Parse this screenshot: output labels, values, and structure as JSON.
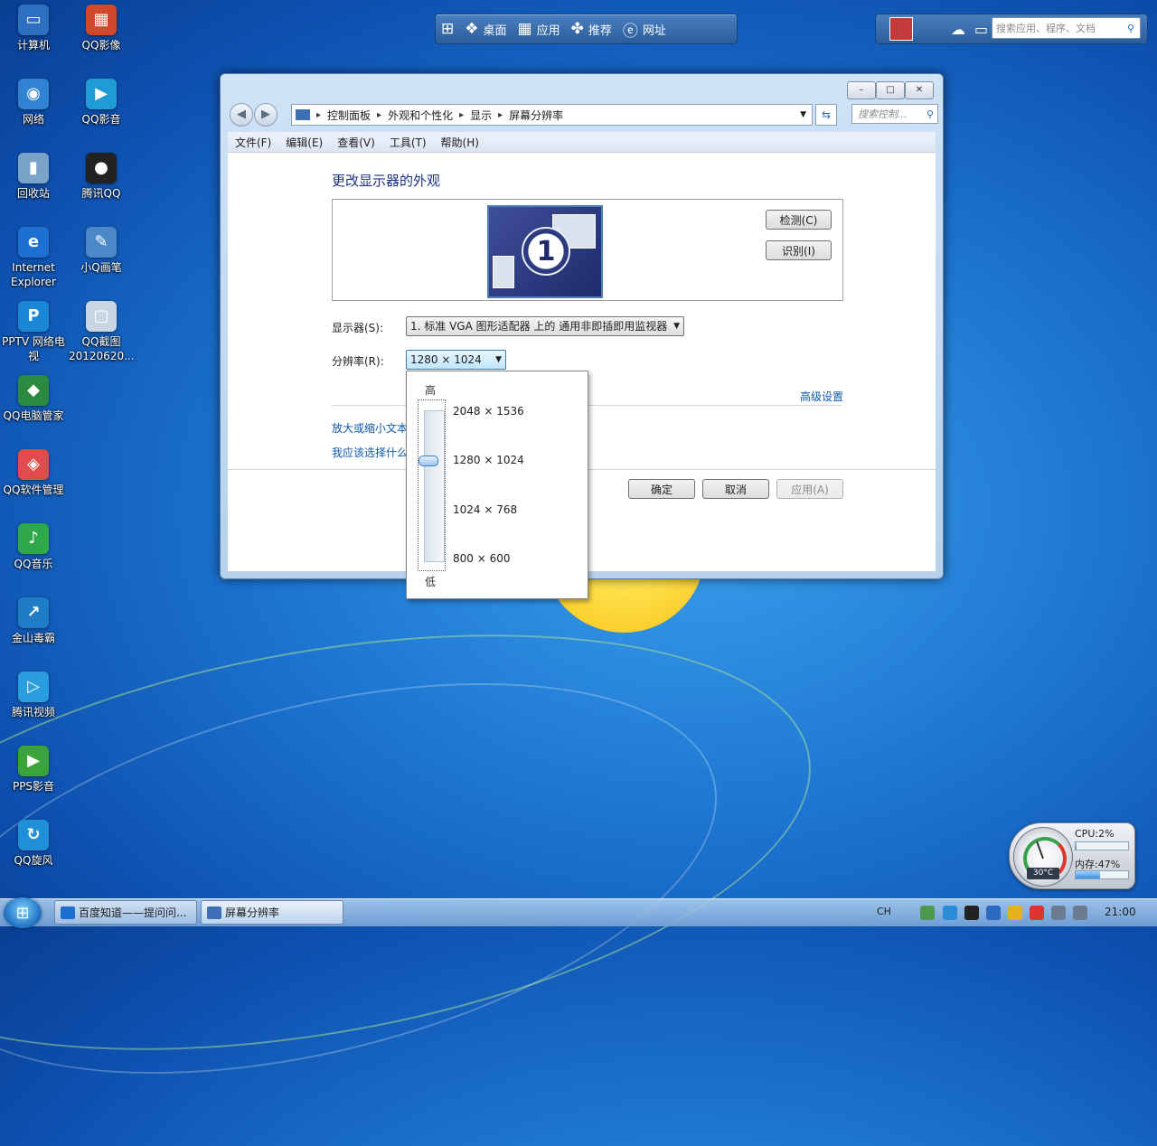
{
  "desktop": {
    "icons": [
      {
        "label": "计算机",
        "glyph": "▭",
        "color": "#2d6fc0"
      },
      {
        "label": "QQ影像",
        "glyph": "▦",
        "color": "#d2482a"
      },
      {
        "label": "网络",
        "glyph": "◉",
        "color": "#2f83d2"
      },
      {
        "label": "QQ影音",
        "glyph": "▶",
        "color": "#1f9bd8"
      },
      {
        "label": "回收站",
        "glyph": "▮",
        "color": "#7aa3c9"
      },
      {
        "label": "腾讯QQ",
        "glyph": "●",
        "color": "#222222"
      },
      {
        "label": "Internet Explorer",
        "glyph": "e",
        "color": "#1d6fd1"
      },
      {
        "label": "小Q画笔",
        "glyph": "✎",
        "color": "#4a88c7"
      },
      {
        "label": "PPTV 网络电视",
        "glyph": "P",
        "color": "#1a86d6"
      },
      {
        "label": "QQ截图 20120620...",
        "glyph": "▢",
        "color": "#c9d6e3"
      },
      {
        "label": "QQ电脑管家",
        "glyph": "◆",
        "color": "#2a8a3f"
      },
      {
        "label": "QQ软件管理",
        "glyph": "◈",
        "color": "#e04b4b"
      },
      {
        "label": "QQ音乐",
        "glyph": "♪",
        "color": "#2fa84a"
      },
      {
        "label": "金山毒霸",
        "glyph": "↗",
        "color": "#1f7cc6"
      },
      {
        "label": "腾讯视频",
        "glyph": "▷",
        "color": "#2a9de0"
      },
      {
        "label": "PPS影音",
        "glyph": "▶",
        "color": "#3aa33a"
      },
      {
        "label": "QQ旋风",
        "glyph": "↻",
        "color": "#1f8fd8"
      }
    ]
  },
  "topbar": {
    "items": [
      {
        "icon": "桌",
        "label": "桌面"
      },
      {
        "icon": "▦",
        "label": "应用"
      },
      {
        "icon": "✤",
        "label": "推荐"
      },
      {
        "icon": "e",
        "label": "网址"
      }
    ],
    "search_placeholder": "搜索应用、程序、文档"
  },
  "window": {
    "breadcrumb": [
      "控制面板",
      "外观和个性化",
      "显示",
      "屏幕分辨率"
    ],
    "search_placeholder": "搜索控制...",
    "menu": [
      "文件(F)",
      "编辑(E)",
      "查看(V)",
      "工具(T)",
      "帮助(H)"
    ],
    "heading": "更改显示器的外观",
    "monitor_number": "1",
    "detect_button": "检测(C)",
    "identify_button": "识别(I)",
    "display_label": "显示器(S):",
    "display_value": "1. 标准 VGA 图形适配器 上的 通用非即插即用监视器",
    "resolution_label": "分辨率(R):",
    "resolution_value": "1280 × 1024",
    "advanced_link": "高级设置",
    "link_text_size": "放大或缩小文本",
    "link_which": "我应该选择什么",
    "ok_button": "确定",
    "cancel_button": "取消",
    "apply_button": "应用(A)"
  },
  "resolution_dropdown": {
    "high_label": "高",
    "low_label": "低",
    "options": [
      "2048 × 1536",
      "1280 × 1024",
      "1024 × 768",
      "800 × 600"
    ],
    "selected": "1280 × 1024"
  },
  "gadget": {
    "cpu_label": "CPU:2%",
    "cpu_percent": 2,
    "mem_label": "内存:47%",
    "mem_percent": 47,
    "temp": "30°C"
  },
  "taskbar": {
    "tasks": [
      "百度知道——提问问...",
      "屏幕分辨率"
    ],
    "lang": "CH",
    "clock": "21:00"
  }
}
